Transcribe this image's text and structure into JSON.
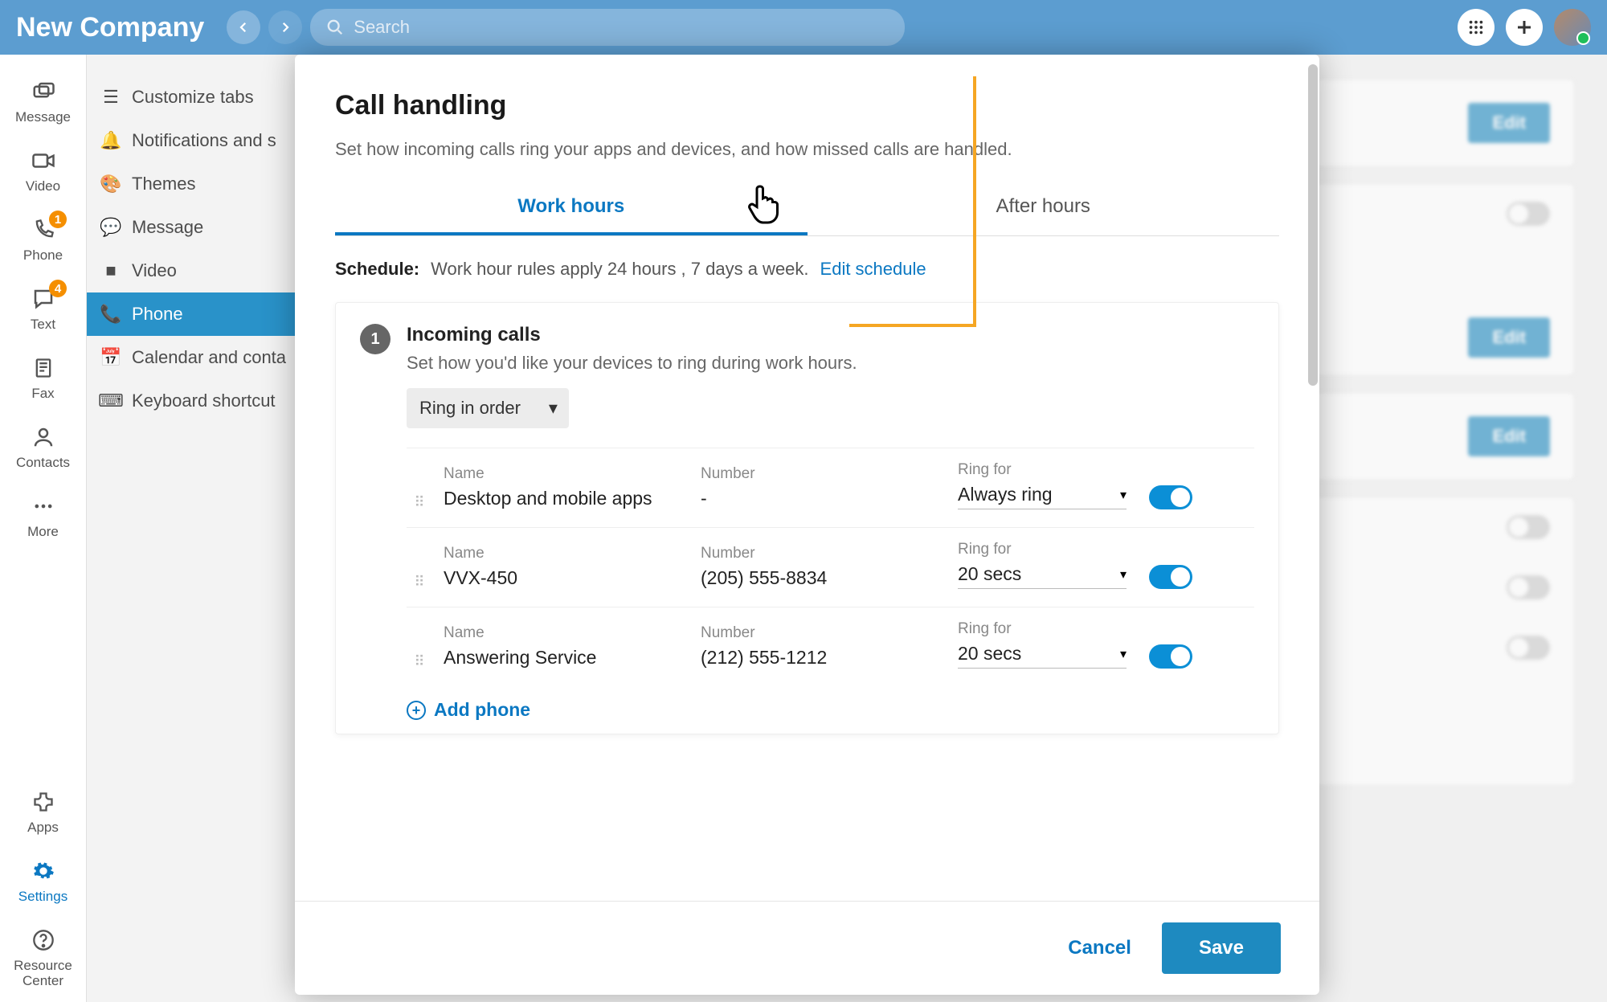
{
  "topbar": {
    "company": "New Company",
    "search_placeholder": "Search"
  },
  "leftrail": [
    {
      "label": "Message",
      "icon": "message"
    },
    {
      "label": "Video",
      "icon": "video"
    },
    {
      "label": "Phone",
      "icon": "phone",
      "badge": "1"
    },
    {
      "label": "Text",
      "icon": "text",
      "badge": "4"
    },
    {
      "label": "Fax",
      "icon": "fax"
    },
    {
      "label": "Contacts",
      "icon": "contacts"
    },
    {
      "label": "More",
      "icon": "more"
    }
  ],
  "leftrail_bottom": [
    {
      "label": "Apps",
      "icon": "apps"
    },
    {
      "label": "Settings",
      "icon": "settings",
      "active": true
    },
    {
      "label": "Resource Center",
      "icon": "help"
    }
  ],
  "settings_sidebar": [
    {
      "label": "Customize tabs",
      "icon": "tabs"
    },
    {
      "label": "Notifications and s",
      "icon": "bell"
    },
    {
      "label": "Themes",
      "icon": "palette"
    },
    {
      "label": "Message",
      "icon": "message"
    },
    {
      "label": "Video",
      "icon": "video"
    },
    {
      "label": "Phone",
      "icon": "phone",
      "active": true
    },
    {
      "label": "Calendar and conta",
      "icon": "calendar"
    },
    {
      "label": "Keyboard shortcut",
      "icon": "keyboard"
    }
  ],
  "bg_actions": {
    "edit": "Edit"
  },
  "modal": {
    "title": "Call handling",
    "desc": "Set how incoming calls ring your apps and devices, and how missed calls are handled.",
    "tabs": {
      "work": "Work hours",
      "after": "After hours"
    },
    "schedule": {
      "label": "Schedule:",
      "text": "Work hour rules apply 24 hours , 7 days a week.",
      "edit": "Edit schedule"
    },
    "section1": {
      "num": "1",
      "title": "Incoming calls",
      "desc": "Set how you'd like your devices to ring during work hours.",
      "ring_mode": "Ring in order",
      "cols": {
        "name": "Name",
        "number": "Number",
        "ringfor": "Ring for"
      },
      "devices": [
        {
          "name": "Desktop and mobile apps",
          "number": "-",
          "ringfor": "Always ring"
        },
        {
          "name": "VVX-450",
          "number": "(205) 555-8834",
          "ringfor": "20 secs"
        },
        {
          "name": "Answering Service",
          "number": "(212) 555-1212",
          "ringfor": "20 secs"
        }
      ],
      "add": "Add phone"
    },
    "footer": {
      "cancel": "Cancel",
      "save": "Save"
    }
  }
}
